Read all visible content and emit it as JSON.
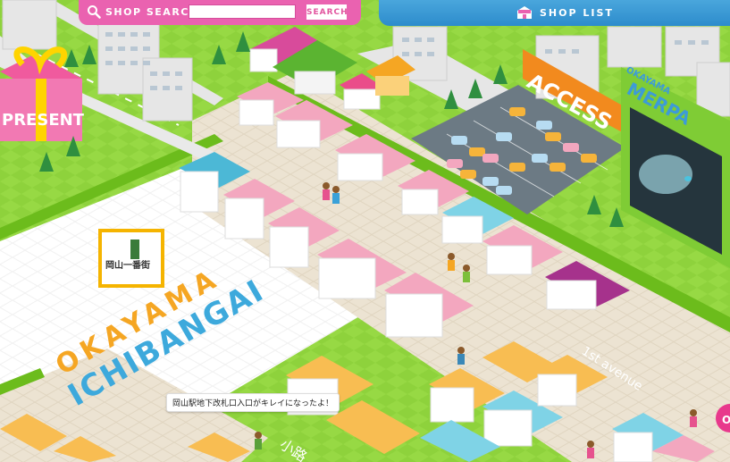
{
  "header": {
    "search_label": "SHOP SEARCH",
    "search_input_value": "",
    "search_button_label": "SEARCH",
    "shop_list_label": "SHOP LIST"
  },
  "map": {
    "district_sign_1": "OKAYAMA",
    "district_sign_2": "ICHIBANGAI",
    "gate_sign": "岡山一番街",
    "access_billboard": "ACCESS",
    "meriba_sign_1": "OKAYAMA",
    "meriba_sign_2": "MERPA",
    "street_label": "1st avenue",
    "path_label": "小路",
    "present_label": "PRESENT",
    "corner_badge": "O",
    "tooltip": "岡山駅地下改札口入口がキレイになったよ！"
  },
  "colors": {
    "grass": "#8ed23c",
    "grass_dark": "#6cbc1c",
    "plaza": "#ffffff",
    "road": "#e9e1d0",
    "parking": "#6c7a84",
    "accent_pink": "#ea62b0",
    "accent_blue": "#3d9bd7",
    "shop_pink": "#f3a7bf",
    "shop_orange": "#f8bd52",
    "shop_blue": "#7fd3e6",
    "shop_purple": "#a6328c"
  }
}
